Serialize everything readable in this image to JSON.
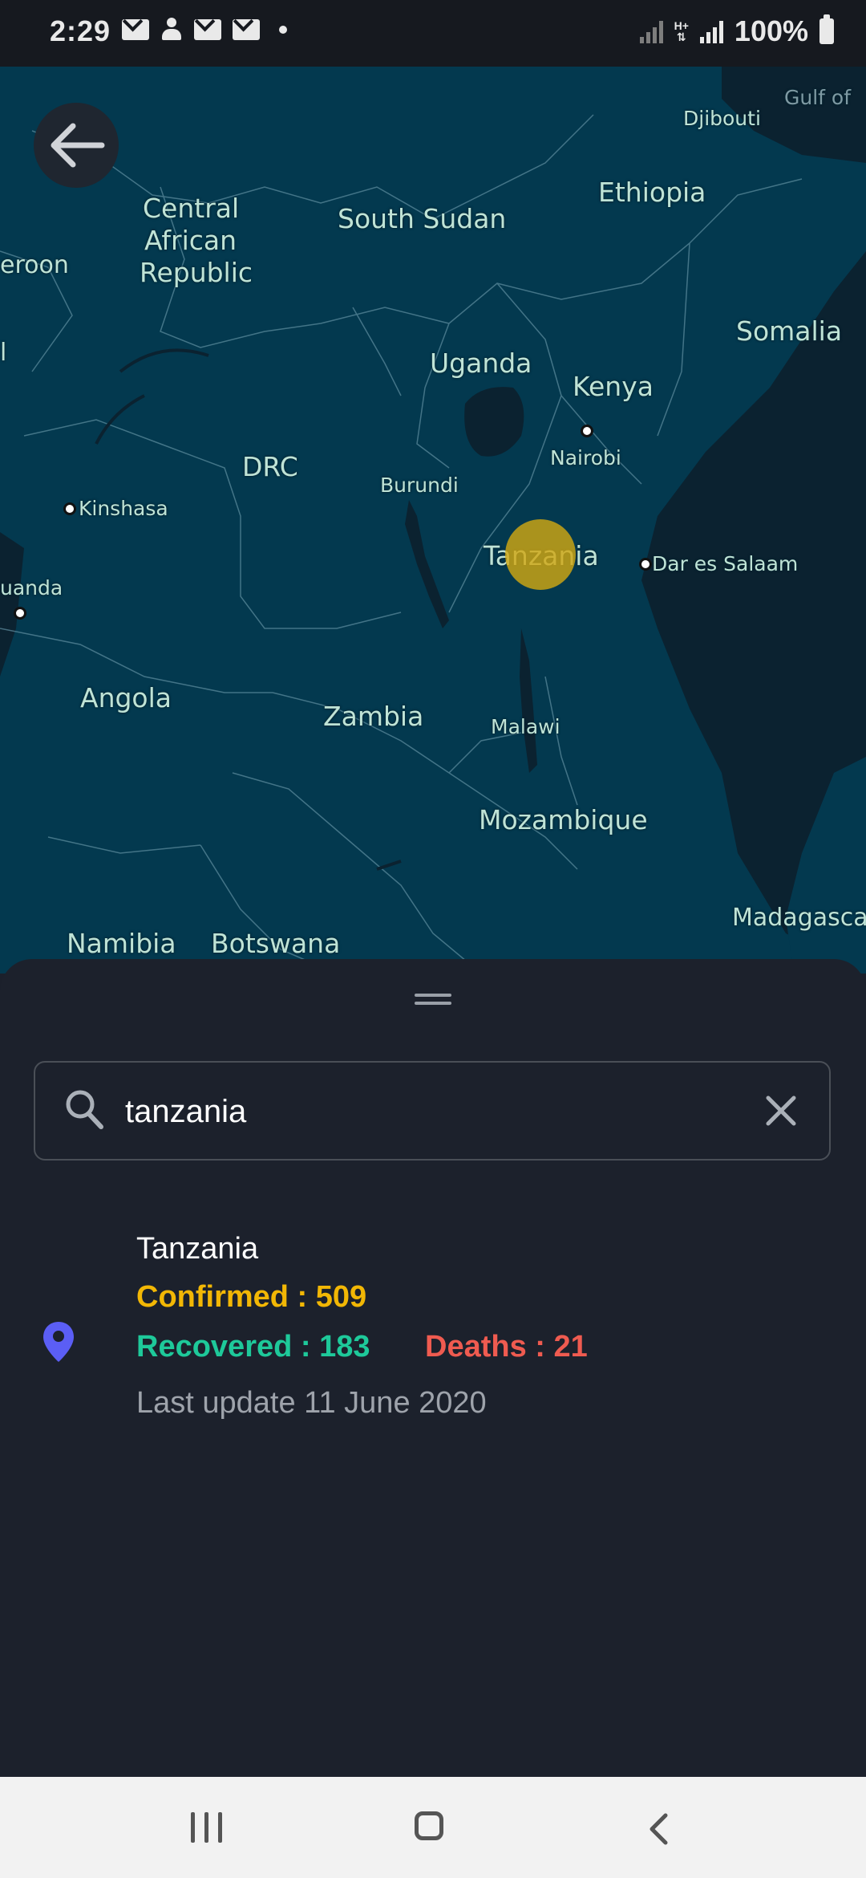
{
  "status_bar": {
    "time": "2:29",
    "battery": "100%",
    "network": "H+"
  },
  "map": {
    "labels": {
      "djibouti": "Djibouti",
      "gulf": "Gulf of",
      "ethiopia": "Ethiopia",
      "central_african_1": "Central",
      "central_african_2": "African",
      "central_african_3": "Republic",
      "south_sudan": "South Sudan",
      "cameroon": "eroon",
      "somalia": "Somalia",
      "uganda": "Uganda",
      "kenya": "Kenya",
      "nairobi": "Nairobi",
      "drc": "DRC",
      "burundi": "Burundi",
      "kinshasa": "Kinshasa",
      "tanzania": "Tanzania",
      "dar_es_salaam": "Dar es Salaam",
      "luanda": "uanda",
      "angola": "Angola",
      "zambia": "Zambia",
      "malawi": "Malawi",
      "mozambique": "Mozambique",
      "madagascar": "Madagasca",
      "namibia": "Namibia",
      "botswana": "Botswana",
      "left_edge": "l"
    },
    "marker_color": "#cfa712"
  },
  "search": {
    "value": "tanzania"
  },
  "result": {
    "country": "Tanzania",
    "confirmed": "Confirmed : 509",
    "recovered": "Recovered : 183",
    "deaths": "Deaths : 21",
    "last_update": "Last update 11 June 2020"
  },
  "colors": {
    "confirmed": "#f2b705",
    "recovered": "#1ec99a",
    "deaths": "#ef5b50",
    "pin": "#5b5ef5"
  }
}
